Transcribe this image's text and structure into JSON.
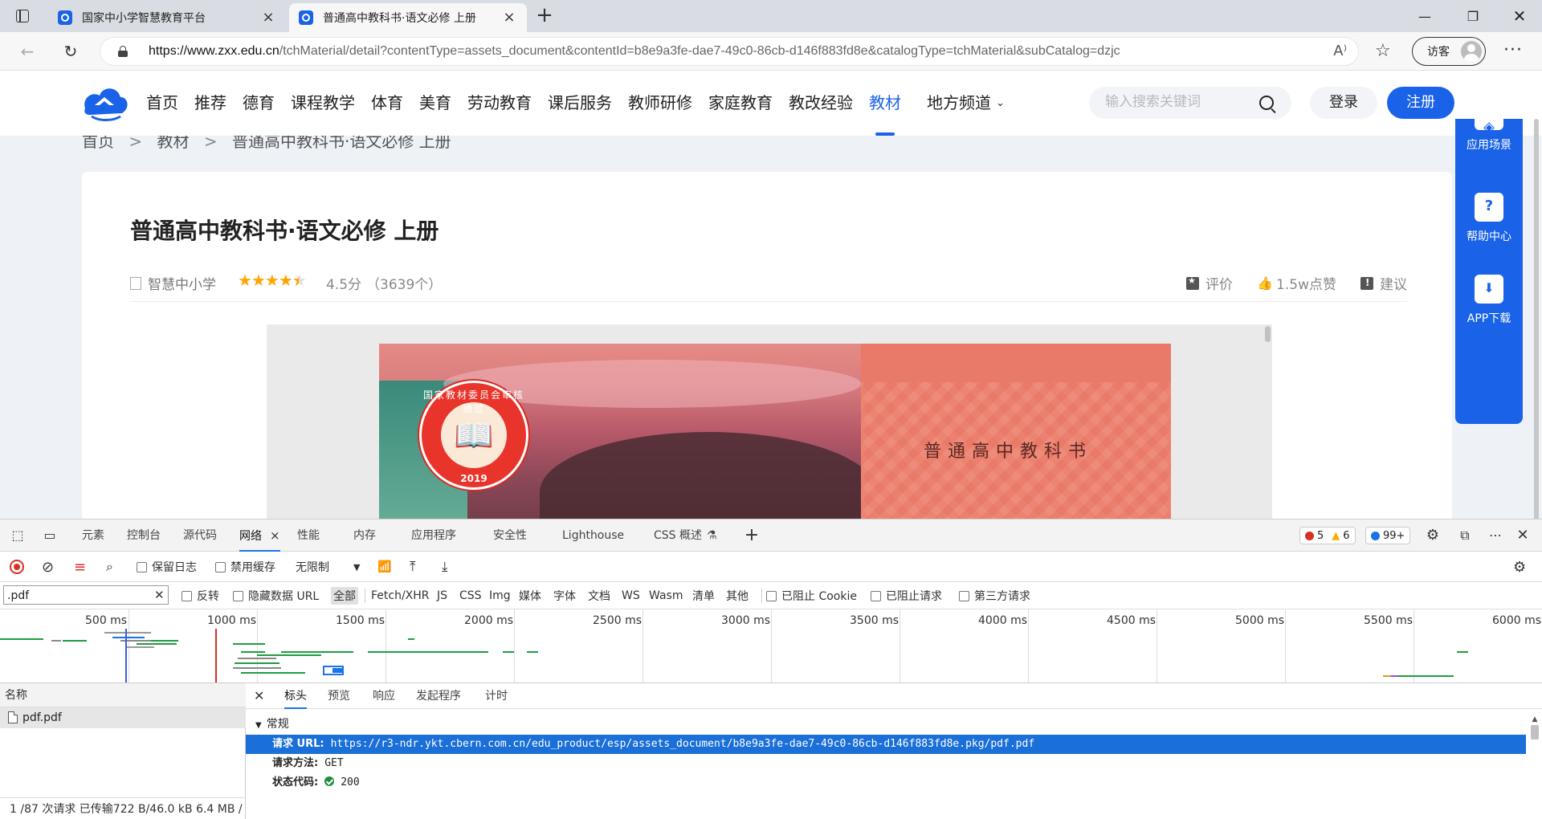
{
  "browser": {
    "tabs": [
      {
        "title": "国家中小学智慧教育平台",
        "active": false
      },
      {
        "title": "普通高中教科书·语文必修 上册",
        "active": true
      }
    ],
    "url_host": "https://www.zxx.edu.cn",
    "url_path": "/tchMaterial/detail?contentType=assets_document&contentId=b8e9a3fe-dae7-49c0-86cb-d146f883fd8e&catalogType=tchMaterial&subCatalog=dzjc",
    "read_aloud": "A⁾",
    "profile_label": "访客"
  },
  "site": {
    "nav": [
      "首页",
      "推荐",
      "德育",
      "课程教学",
      "体育",
      "美育",
      "劳动教育",
      "课后服务",
      "教师研修",
      "家庭教育",
      "教改经验",
      "教材",
      "地方频道"
    ],
    "active_nav": "教材",
    "search_placeholder": "输入搜索关键词",
    "login": "登录",
    "register": "注册"
  },
  "breadcrumb": [
    "首页",
    "教材",
    "普通高中教科书·语文必修 上册"
  ],
  "breadcrumb_sep": ">",
  "doc": {
    "title": "普通高中教科书·语文必修 上册",
    "source": "智慧中小学",
    "rating": 4.5,
    "score_text": "4.5分",
    "count_text": "（3639个）",
    "actions": [
      "评价",
      "1.5w点赞",
      "建议"
    ]
  },
  "cover": {
    "book_title": "普通高中教科书",
    "seal_text": "国家教材委员会审核通过",
    "seal_year": "2019"
  },
  "side_panel": [
    "应用场景",
    "帮助中心",
    "APP下载"
  ],
  "devtools": {
    "tabs": [
      "元素",
      "控制台",
      "源代码",
      "网络",
      "性能",
      "内存",
      "应用程序",
      "安全性",
      "Lighthouse",
      "CSS 概述"
    ],
    "active_tab": "网络",
    "errors": "5",
    "warnings": "6",
    "messages": "99+",
    "toolbar": {
      "preserve_log": "保留日志",
      "disable_cache": "禁用缓存",
      "throttle": "无限制"
    },
    "filter": {
      "value": ".pdf",
      "invert": "反转",
      "hide_data_url": "隐藏数据 URL",
      "types": [
        "全部",
        "Fetch/XHR",
        "JS",
        "CSS",
        "Img",
        "媒体",
        "字体",
        "文档",
        "WS",
        "Wasm",
        "清单",
        "其他"
      ],
      "blocked_cookies": "已阻止 Cookie",
      "blocked_requests": "已阻止请求",
      "third_party": "第三方请求"
    },
    "timeline_ticks": [
      "500 ms",
      "1000 ms",
      "1500 ms",
      "2000 ms",
      "2500 ms",
      "3000 ms",
      "3500 ms",
      "4000 ms",
      "4500 ms",
      "5000 ms",
      "5500 ms",
      "6000 ms"
    ],
    "list_header": "名称",
    "requests": [
      "pdf.pdf"
    ],
    "status_text": "1 /87 次请求  已传输722 B/46.0 kB  6.4 MB /",
    "detail_tabs": [
      "标头",
      "预览",
      "响应",
      "发起程序",
      "计时"
    ],
    "active_detail_tab": "标头",
    "general_section": "常规",
    "general": {
      "request_url_label": "请求 URL:",
      "request_url": "https://r3-ndr.ykt.cbern.com.cn/edu_product/esp/assets_document/b8e9a3fe-dae7-49c0-86cb-d146f883fd8e.pkg/pdf.pdf",
      "method_label": "请求方法:",
      "method": "GET",
      "status_label": "状态代码:",
      "status": "200"
    }
  },
  "colors": {
    "brand": "#1a63e8",
    "selection": "#1a6fd8",
    "star": "#ffa400",
    "error": "#d93025",
    "warning": "#f9ab00",
    "info": "#1a73e8"
  }
}
